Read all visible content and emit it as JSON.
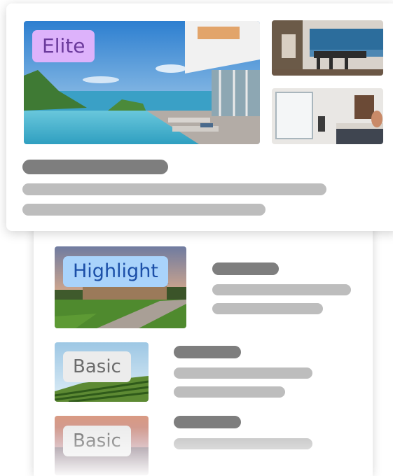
{
  "elite": {
    "badge": "Elite"
  },
  "listings": [
    {
      "badge": "Highlight"
    },
    {
      "badge": "Basic"
    },
    {
      "badge": "Basic"
    }
  ]
}
